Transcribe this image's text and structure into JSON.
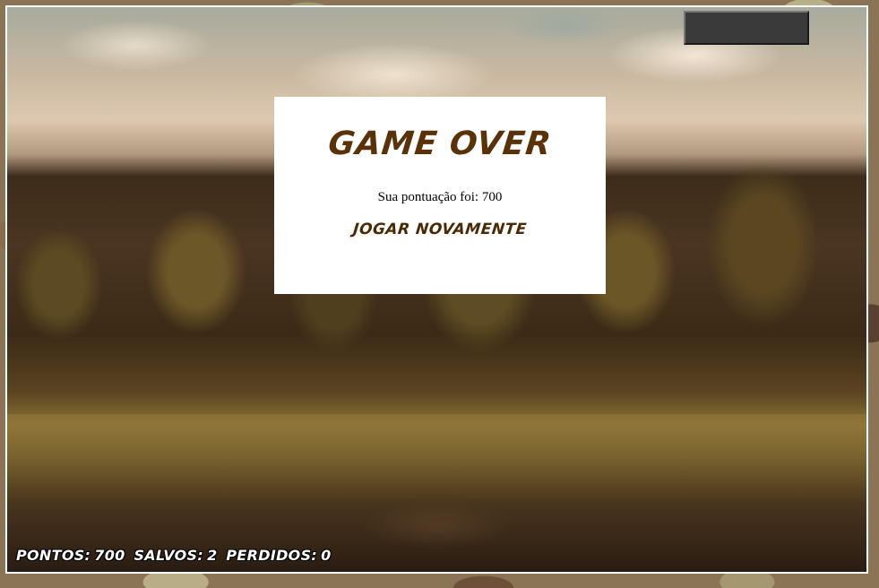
{
  "game_over": {
    "title": "GAME OVER",
    "score_text": "Sua pontuação foi: 700",
    "play_again_label": "JOGAR NOVAMENTE"
  },
  "hud": {
    "points_label": "PONTOS:",
    "points_value": "700",
    "saved_label": "SALVOS:",
    "saved_value": "2",
    "lost_label": "PERDIDOS:",
    "lost_value": "0"
  },
  "colors": {
    "title": "#5a3208",
    "dialog_background": "#ffffff",
    "frame_border": "#ffffff",
    "top_button": "#3a3a3a"
  }
}
